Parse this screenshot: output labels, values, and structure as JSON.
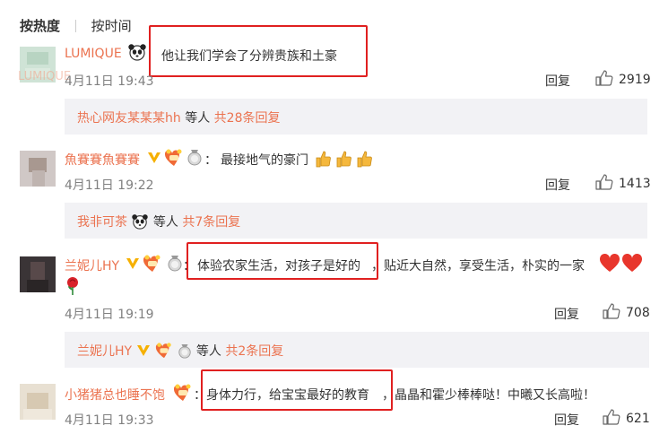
{
  "tabs": {
    "hot": "按热度",
    "time": "按时间"
  },
  "comments": [
    {
      "user": "LUMIQUE",
      "user_ghost": "LUMIQUE",
      "text_boxed": "他让我们学会了分辨贵族和土豪",
      "time": "4月11日 19:43",
      "reply": "回复",
      "likes": "2919",
      "thread": {
        "users": "热心网友某某某hh",
        "etc": "等人",
        "count": "共28条回复"
      }
    },
    {
      "user": "魚賽賽魚賽賽",
      "sep": "：",
      "text": "最接地气的豪门",
      "time": "4月11日 19:22",
      "reply": "回复",
      "likes": "1413",
      "thread": {
        "users": "我非可茶",
        "etc": "等人",
        "count": "共7条回复"
      }
    },
    {
      "user": "兰妮儿HY",
      "sep": "：",
      "text_boxed": "体验农家生活，对孩子是好的",
      "text_rest": "，贴近大自然，享受生活，朴实的一家",
      "time": "4月11日 19:19",
      "reply": "回复",
      "likes": "708",
      "thread": {
        "users": "兰妮儿HY",
        "etc": "等人",
        "count": "共2条回复"
      }
    },
    {
      "user": "小猪猪总也睡不饱",
      "sep": "：",
      "text_boxed": "身体力行，给宝宝最好的教育",
      "text_rest": "，晶晶和霍少棒棒哒！中曦又长高啦！",
      "time": "4月11日 19:33",
      "reply": "回复",
      "likes": "621"
    }
  ],
  "colors": {
    "username": "#eb7350",
    "highlight_box": "#e02020",
    "reply_bg": "#f2f2f5"
  }
}
